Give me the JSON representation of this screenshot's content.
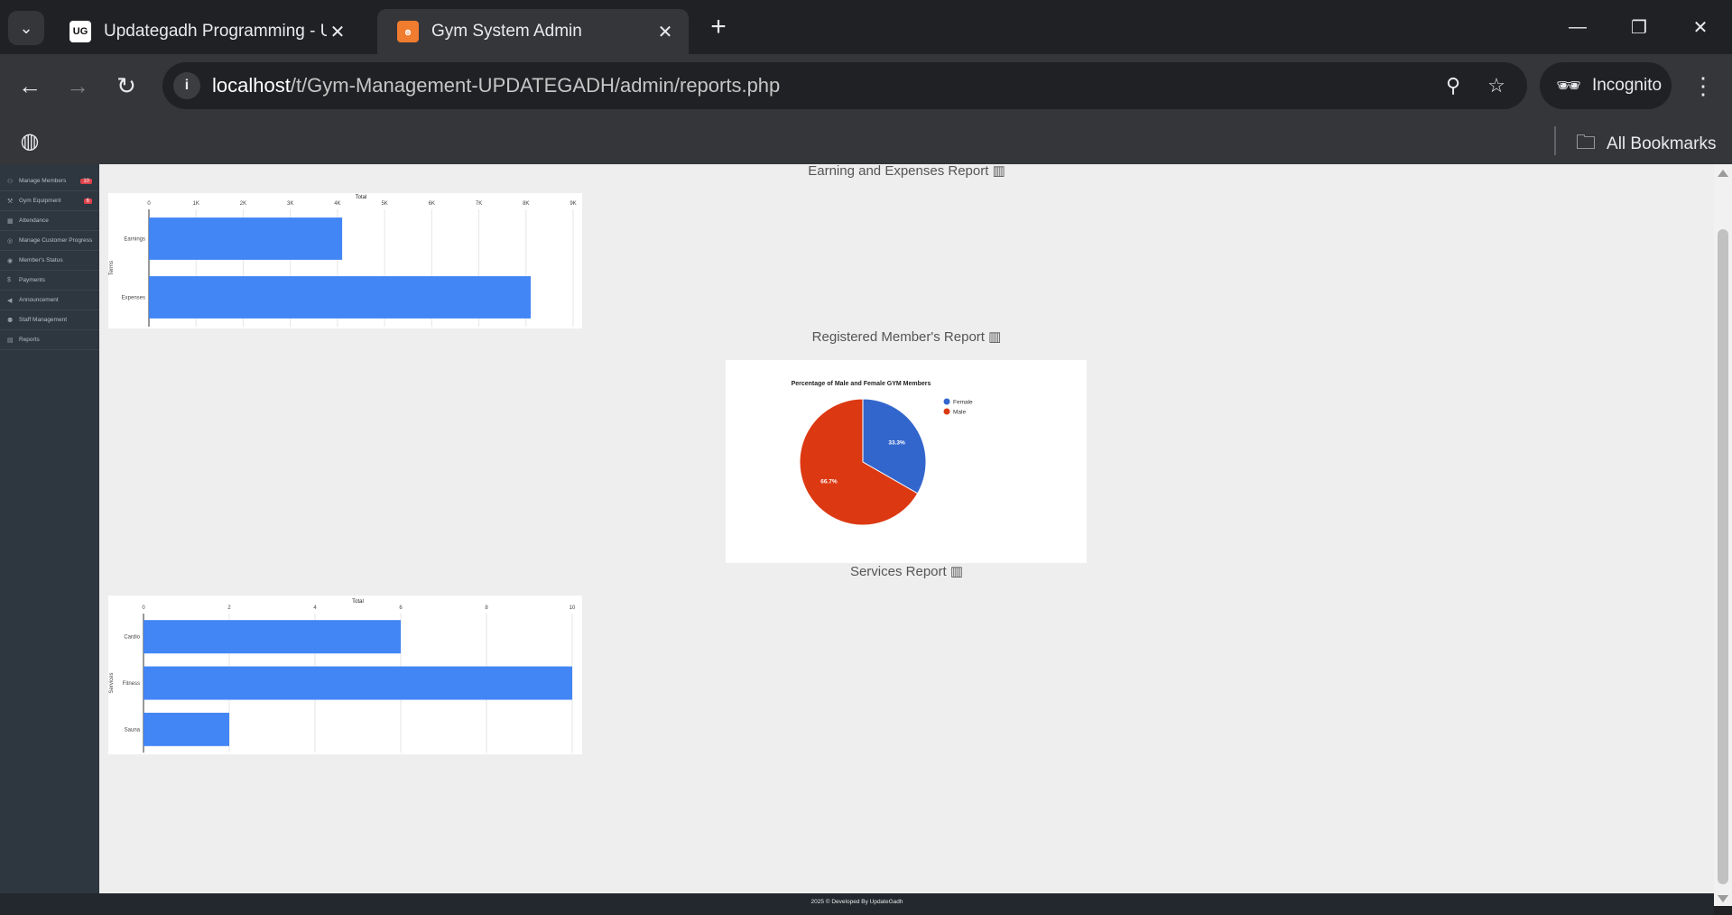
{
  "browser": {
    "tabs": [
      {
        "title": "Updategadh Programming - Up",
        "favicon": "UG",
        "active": false
      },
      {
        "title": "Gym System Admin",
        "favicon": "xampp-icon",
        "active": true
      }
    ],
    "url_host": "localhost",
    "url_path": "/t/Gym-Management-UPDATEGADH/admin/reports.php",
    "incognito_label": "Incognito",
    "all_bookmarks_label": "All Bookmarks"
  },
  "sidebar": {
    "items": [
      {
        "label": "Manage Members",
        "icon": "users-icon",
        "badge": "10"
      },
      {
        "label": "Gym Equipment",
        "icon": "equipment-icon",
        "badge": "6"
      },
      {
        "label": "Attendance",
        "icon": "calendar-icon",
        "badge": ""
      },
      {
        "label": "Manage Customer Progress",
        "icon": "progress-icon",
        "badge": ""
      },
      {
        "label": "Member's Status",
        "icon": "eye-icon",
        "badge": ""
      },
      {
        "label": "Payments",
        "icon": "dollar-icon",
        "badge": ""
      },
      {
        "label": "Announcement",
        "icon": "megaphone-icon",
        "badge": ""
      },
      {
        "label": "Staff Management",
        "icon": "staff-icon",
        "badge": ""
      },
      {
        "label": "Reports",
        "icon": "file-icon",
        "badge": ""
      }
    ]
  },
  "reports": {
    "earnings_title": "Earning and Expenses Report",
    "members_title": "Registered Member's Report",
    "services_title": "Services Report"
  },
  "chart_data": [
    {
      "type": "bar",
      "orientation": "horizontal",
      "title": "Total",
      "ylabel": "Terms",
      "categories": [
        "Earnings",
        "Expenses"
      ],
      "values": [
        4100,
        8100
      ],
      "xlim": [
        0,
        9000
      ],
      "ticks": [
        "0",
        "1K",
        "2K",
        "3K",
        "4K",
        "5K",
        "6K",
        "7K",
        "8K",
        "9K"
      ],
      "color": "#4285f4",
      "grid": true
    },
    {
      "type": "pie",
      "title": "Percentage of Male and Female GYM Members",
      "categories": [
        "Female",
        "Male"
      ],
      "values": [
        33.3,
        66.7
      ],
      "labels": [
        "33.3%",
        "66.7%"
      ],
      "colors": [
        "#3366cc",
        "#dc3912"
      ],
      "legend": "right"
    },
    {
      "type": "bar",
      "orientation": "horizontal",
      "title": "Total",
      "ylabel": "Services",
      "categories": [
        "Cardio",
        "Fitness",
        "Sauna"
      ],
      "values": [
        6,
        10,
        2
      ],
      "xlim": [
        0,
        10
      ],
      "ticks": [
        "0",
        "2",
        "4",
        "6",
        "8",
        "10"
      ],
      "color": "#4285f4",
      "grid": true
    }
  ],
  "footer": {
    "text": "2025 © Developed By UpdateGadh"
  }
}
